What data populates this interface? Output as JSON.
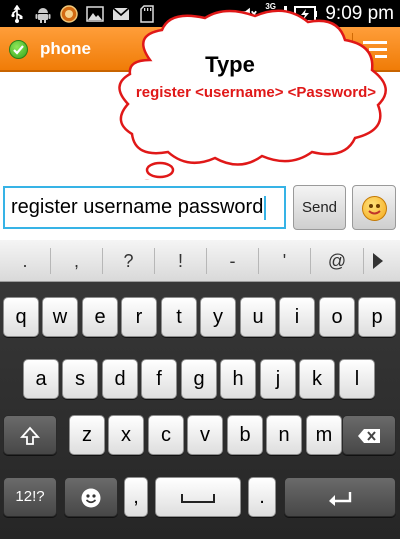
{
  "status_bar": {
    "time": "9:09 pm",
    "network_label": "3G",
    "left_icons": [
      "usb-icon",
      "android-icon",
      "app-icon",
      "image-icon",
      "gmail-icon",
      "sd-card-icon"
    ],
    "right_icons": [
      "mute-icon",
      "signal-icon",
      "battery-icon"
    ]
  },
  "app_bar": {
    "title": "phone",
    "colors": {
      "accent": "#f58a13",
      "online": "#3cba1f"
    }
  },
  "annotation": {
    "title": "Type",
    "command": "register <username> <Password>",
    "bubble_color": "#e01818"
  },
  "input": {
    "value": "register username password"
  },
  "buttons": {
    "send": "Send"
  },
  "keyboard": {
    "suggestions": [
      ".",
      ",",
      "?",
      "!",
      "-",
      "'",
      "@"
    ],
    "row1": [
      "q",
      "w",
      "e",
      "r",
      "t",
      "y",
      "u",
      "i",
      "o",
      "p"
    ],
    "row2": [
      "a",
      "s",
      "d",
      "f",
      "g",
      "h",
      "j",
      "k",
      "l"
    ],
    "row3": [
      "z",
      "x",
      "c",
      "v",
      "b",
      "n",
      "m"
    ],
    "bottom": {
      "symbols_label": "12!?",
      "comma": ",",
      "period": "."
    }
  }
}
